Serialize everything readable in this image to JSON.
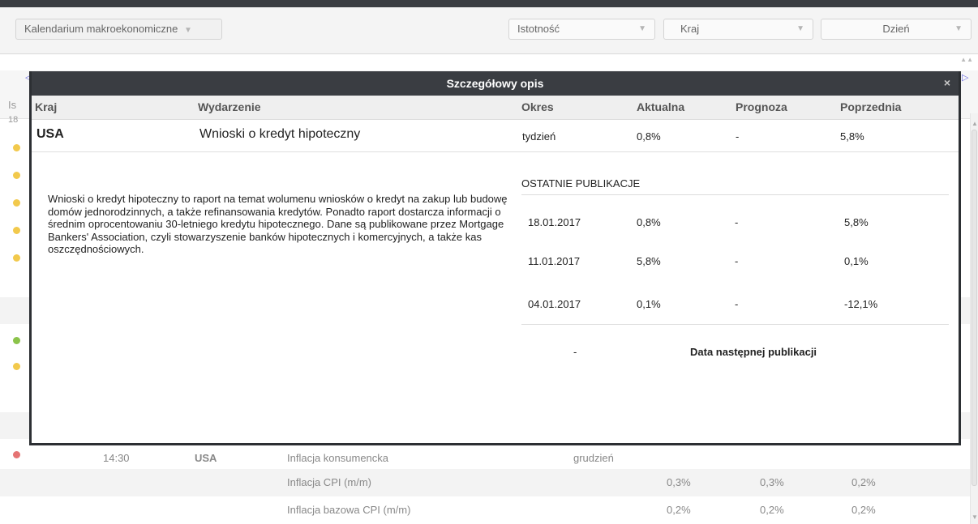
{
  "toolbar": {
    "calendar_select": "Kalendarium makroekonomiczne",
    "importance_select": "Istotność",
    "country_select": "Kraj",
    "day_select": "Dzień"
  },
  "colors": {
    "dark_bar": "#3a3d42",
    "dot_yellow": "#f2c94c",
    "dot_green": "#8bc34a",
    "dot_red": "#e57373"
  },
  "background_partial": {
    "col_label": "Is",
    "date_prefix": "18"
  },
  "background_rows": [
    {
      "time": "14:30",
      "country": "USA",
      "event": "Inflacja konsumencka",
      "period": "grudzień",
      "actual": "",
      "forecast": "",
      "previous": ""
    },
    {
      "time": "",
      "country": "",
      "event": "Inflacja CPI (m/m)",
      "period": "",
      "actual": "0,3%",
      "forecast": "0,3%",
      "previous": "0,2%"
    },
    {
      "time": "",
      "country": "",
      "event": "Inflacja bazowa CPI (m/m)",
      "period": "",
      "actual": "0,2%",
      "forecast": "0,2%",
      "previous": "0,2%"
    }
  ],
  "modal": {
    "title": "Szczegółowy opis",
    "close": "×",
    "headers": {
      "country": "Kraj",
      "event": "Wydarzenie",
      "period": "Okres",
      "actual": "Aktualna",
      "forecast": "Prognoza",
      "previous": "Poprzednia"
    },
    "main": {
      "country": "USA",
      "event": "Wnioski o kredyt hipoteczny",
      "period": "tydzień",
      "actual": "0,8%",
      "forecast": "-",
      "previous": "5,8%"
    },
    "description": "Wnioski o kredyt hipoteczny to raport na temat wolumenu wniosków o kredyt na zakup lub budowę domów jednorodzinnych, a także refinansowania kredytów. Ponadto raport dostarcza informacji o średnim oprocentowaniu 30-letniego kredytu hipotecznego. Dane są publikowane przez Mortgage Bankers' Association, czyli stowarzyszenie banków hipotecznych i komercyjnych, a także kas oszczędnościowych.",
    "recent_label": "OSTATNIE PUBLIKACJE",
    "publications": [
      {
        "date": "18.01.2017",
        "actual": "0,8%",
        "forecast": "-",
        "previous": "5,8%"
      },
      {
        "date": "11.01.2017",
        "actual": "5,8%",
        "forecast": "-",
        "previous": "0,1%"
      },
      {
        "date": "04.01.2017",
        "actual": "0,1%",
        "forecast": "-",
        "previous": "-12,1%"
      }
    ],
    "next_date": "-",
    "next_label": "Data następnej publikacji"
  }
}
